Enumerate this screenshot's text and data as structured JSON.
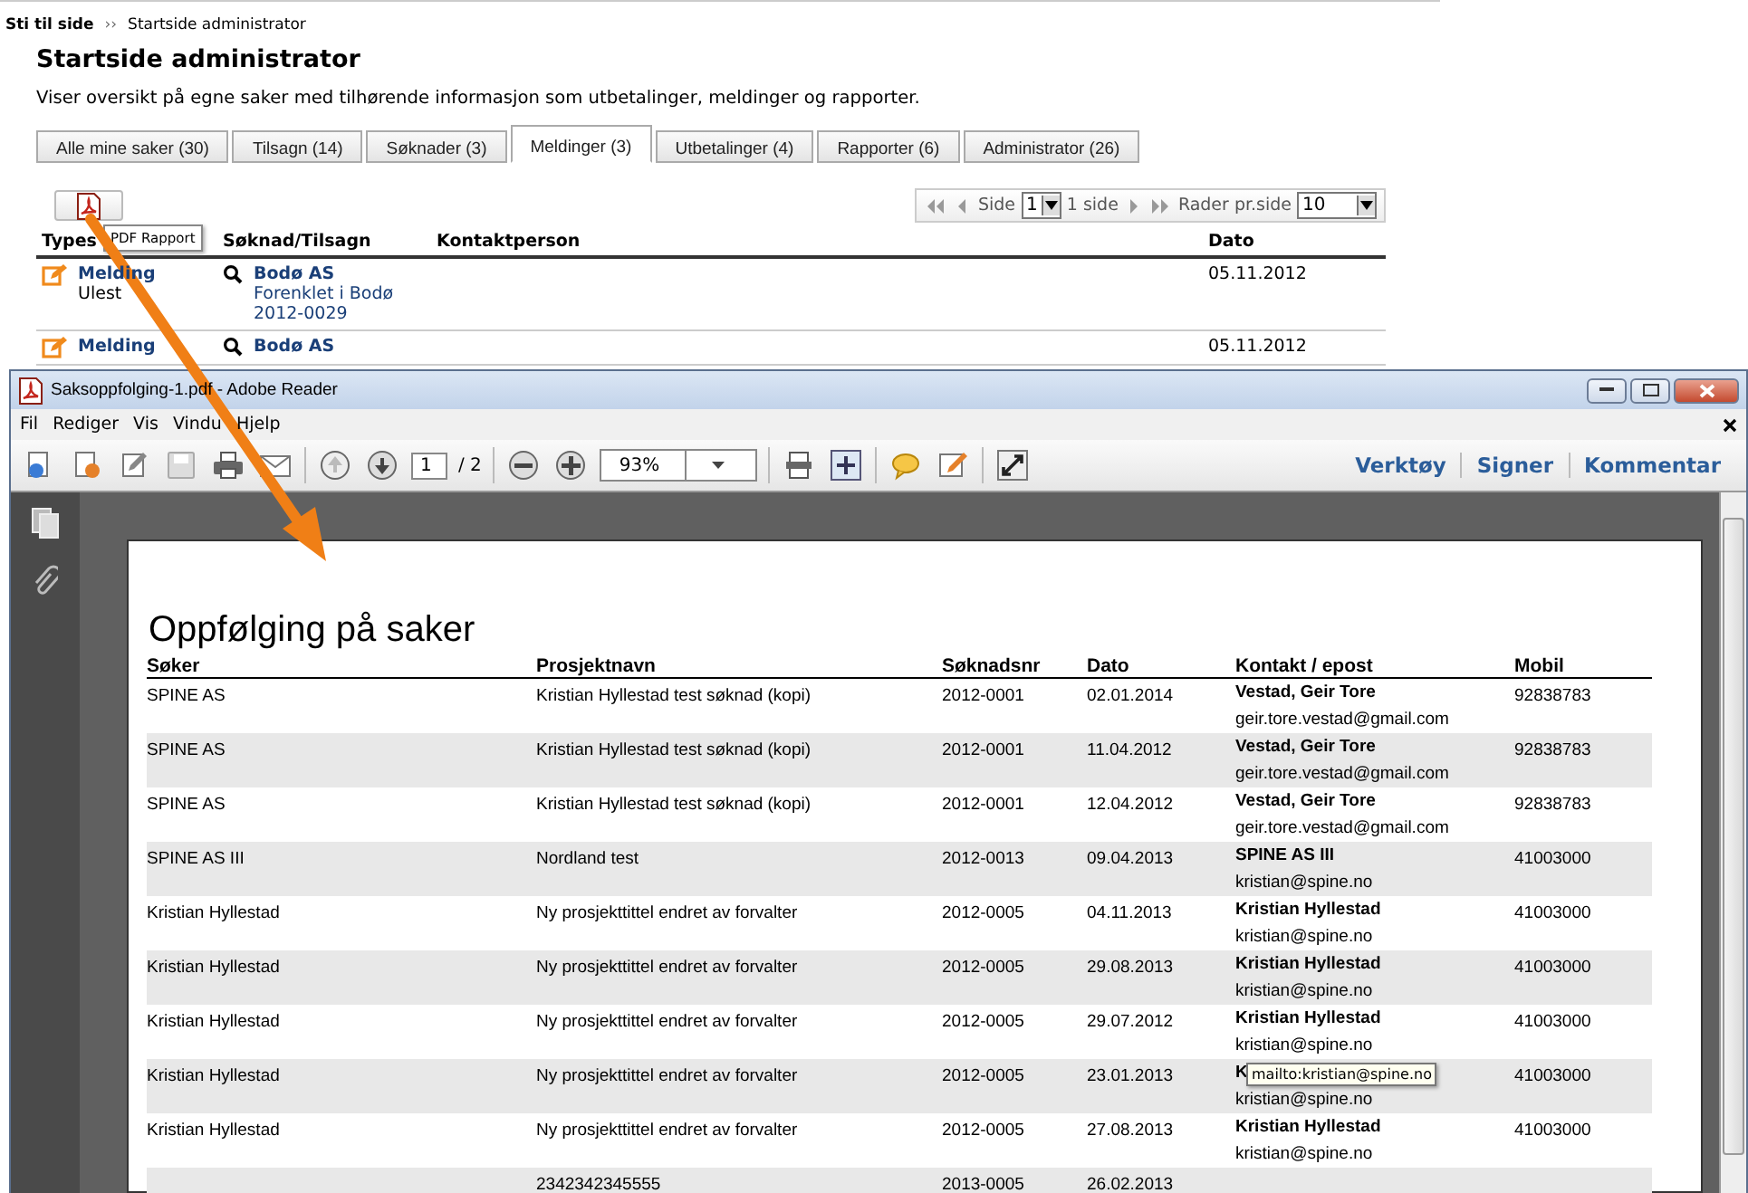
{
  "breadcrumb": {
    "label": "Sti til side",
    "separator": "››",
    "current": "Startside administrator"
  },
  "page": {
    "title": "Startside administrator",
    "description": "Viser oversikt på egne saker med tilhørende informasjon som utbetalinger, meldinger og rapporter."
  },
  "tabs": [
    {
      "label": "Alle mine saker (30)",
      "selected": false
    },
    {
      "label": "Tilsagn (14)",
      "selected": false
    },
    {
      "label": "Søknader (3)",
      "selected": false
    },
    {
      "label": "Meldinger (3)",
      "selected": true
    },
    {
      "label": "Utbetalinger (4)",
      "selected": false
    },
    {
      "label": "Rapporter (6)",
      "selected": false
    },
    {
      "label": "Administrator (26)",
      "selected": false
    }
  ],
  "pdf_button": {
    "tooltip": "PDF Rapport"
  },
  "pager": {
    "page_label": "Side",
    "page": "1",
    "pages": "1 side",
    "rows_label": "Rader pr.side",
    "rows": "10"
  },
  "table": {
    "columns": [
      "Types",
      "Søknad/Tilsagn",
      "Kontaktperson",
      "Dato"
    ],
    "rows": [
      {
        "type": "Melding",
        "status": "Ulest",
        "applicant": "Bodø AS",
        "project": "Forenklet i Bodø",
        "number": "2012-0029",
        "date": "05.11.2012"
      },
      {
        "type": "Melding",
        "applicant": "Bodø AS",
        "date": "05.11.2012"
      }
    ]
  },
  "reader": {
    "title": "Saksoppfolging-1.pdf - Adobe Reader",
    "menu": [
      "Fil",
      "Rediger",
      "Vis",
      "Vindu",
      "Hjelp"
    ],
    "page": "1",
    "page_count": "/ 2",
    "zoom": "93%",
    "actions": [
      "Verktøy",
      "Signer",
      "Kommentar"
    ],
    "document": {
      "title": "Oppfølging på saker",
      "columns": [
        "Søker",
        "Prosjektnavn",
        "Søknadsnr",
        "Dato",
        "Kontakt / epost",
        "Mobil"
      ],
      "rows": [
        {
          "applicant": "SPINE AS",
          "project": "Kristian Hyllestad test søknad (kopi)",
          "number": "2012-0001",
          "date": "02.01.2014",
          "contact": "Vestad, Geir Tore",
          "email": "geir.tore.vestad@gmail.com",
          "mobile": "92838783"
        },
        {
          "applicant": "SPINE AS",
          "project": "Kristian Hyllestad test søknad (kopi)",
          "number": "2012-0001",
          "date": "11.04.2012",
          "contact": "Vestad, Geir Tore",
          "email": "geir.tore.vestad@gmail.com",
          "mobile": "92838783"
        },
        {
          "applicant": "SPINE AS",
          "project": "Kristian Hyllestad test søknad (kopi)",
          "number": "2012-0001",
          "date": "12.04.2012",
          "contact": "Vestad, Geir Tore",
          "email": "geir.tore.vestad@gmail.com",
          "mobile": "92838783"
        },
        {
          "applicant": "SPINE AS III",
          "project": "Nordland test",
          "number": "2012-0013",
          "date": "09.04.2013",
          "contact": "SPINE AS III",
          "email": "kristian@spine.no",
          "mobile": "41003000"
        },
        {
          "applicant": "Kristian Hyllestad",
          "project": "Ny prosjekttittel endret av forvalter",
          "number": "2012-0005",
          "date": "04.11.2013",
          "contact": "Kristian Hyllestad",
          "email": "kristian@spine.no",
          "mobile": "41003000"
        },
        {
          "applicant": "Kristian Hyllestad",
          "project": "Ny prosjekttittel endret av forvalter",
          "number": "2012-0005",
          "date": "29.08.2013",
          "contact": "Kristian Hyllestad",
          "email": "kristian@spine.no",
          "mobile": "41003000"
        },
        {
          "applicant": "Kristian Hyllestad",
          "project": "Ny prosjekttittel endret av forvalter",
          "number": "2012-0005",
          "date": "29.07.2012",
          "contact": "Kristian Hyllestad",
          "email": "kristian@spine.no",
          "mobile": "41003000"
        },
        {
          "applicant": "Kristian Hyllestad",
          "project": "Ny prosjekttittel endret av forvalter",
          "number": "2012-0005",
          "date": "23.01.2013",
          "contact": "K",
          "email": "kristian@spine.no",
          "mobile": "41003000",
          "tooltip": "mailto:kristian@spine.no"
        },
        {
          "applicant": "Kristian Hyllestad",
          "project": "Ny prosjekttittel endret av forvalter",
          "number": "2012-0005",
          "date": "27.08.2013",
          "contact": "Kristian Hyllestad",
          "email": "kristian@spine.no",
          "mobile": "41003000"
        },
        {
          "project": "2342342345555",
          "number": "2013-0005",
          "date": "26.02.2013"
        }
      ]
    }
  }
}
